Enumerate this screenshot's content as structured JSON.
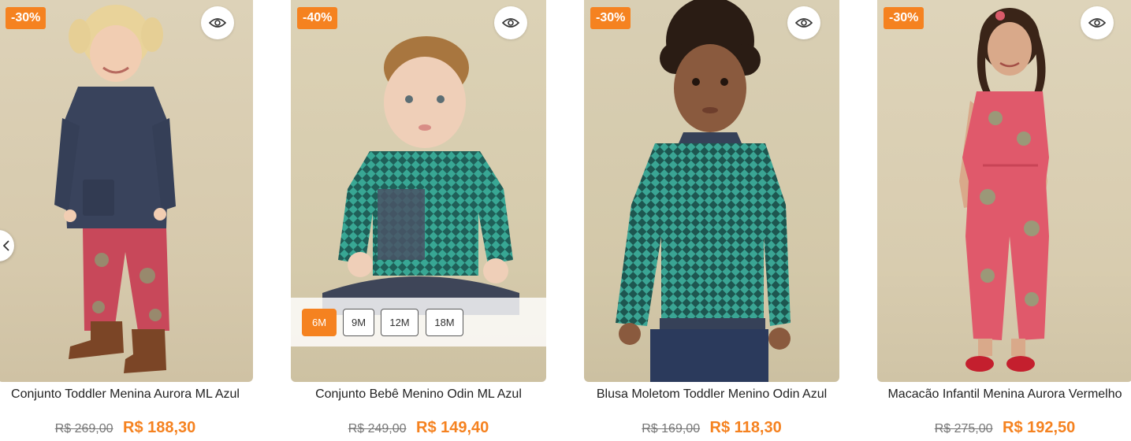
{
  "carousel": {
    "prev_icon": "chevron-left-icon",
    "products": [
      {
        "discount": "-30%",
        "quickview_icon": "eye-icon",
        "title": "Conjunto Toddler Menina Aurora ML Azul",
        "old_price": "R$ 269,00",
        "price": "R$ 188,30",
        "sizes": []
      },
      {
        "discount": "-40%",
        "quickview_icon": "eye-icon",
        "title": "Conjunto Bebê Menino Odin ML Azul",
        "old_price": "R$ 249,00",
        "price": "R$ 149,40",
        "sizes": [
          "6M",
          "9M",
          "12M",
          "18M"
        ],
        "selected_size": "6M"
      },
      {
        "discount": "-30%",
        "quickview_icon": "eye-icon",
        "title": "Blusa Moletom Toddler Menino Odin Azul",
        "old_price": "R$ 169,00",
        "price": "R$ 118,30",
        "sizes": []
      },
      {
        "discount": "-30%",
        "quickview_icon": "eye-icon",
        "title": "Macacão Infantil Menina Aurora Vermelho",
        "old_price": "R$ 275,00",
        "price": "R$ 192,50",
        "sizes": []
      }
    ]
  },
  "colors": {
    "accent": "#f58220",
    "text": "#222222",
    "muted": "#777777"
  }
}
